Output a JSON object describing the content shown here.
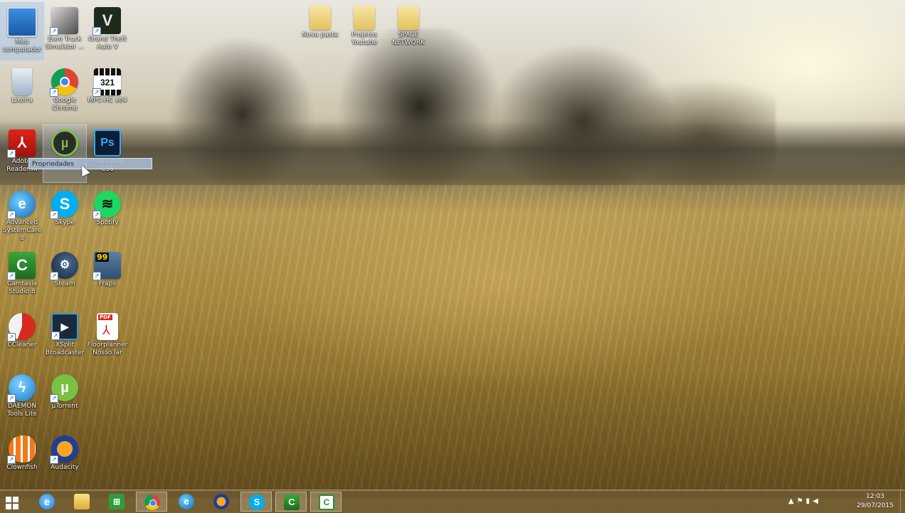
{
  "desktop": {
    "icons": [
      {
        "label": "Meu computador",
        "icon": "computer-icon"
      },
      {
        "label": "Euro Truck Simulator ...",
        "icon": "truck-icon"
      },
      {
        "label": "Grand Theft Auto V",
        "icon": "gta-icon"
      },
      {
        "label": "Lixeira",
        "icon": "recycle-bin-icon"
      },
      {
        "label": "Google Chrome",
        "icon": "chrome-icon"
      },
      {
        "label": "MPC-HC x64",
        "icon": "mpc-hc-icon"
      },
      {
        "label": "Adobe Reader XI",
        "icon": "acrobat-icon"
      },
      {
        "label": "uTorrent",
        "icon": "utorrent-icon"
      },
      {
        "label": "Photoshop CS6",
        "icon": "photoshop-icon"
      },
      {
        "label": "Advanced SystemCare 8",
        "icon": "advanced-systemcare-icon"
      },
      {
        "label": "Skype",
        "icon": "skype-icon"
      },
      {
        "label": "Spotify",
        "icon": "spotify-icon"
      },
      {
        "label": "Camtasia Studio 8",
        "icon": "camtasia-icon"
      },
      {
        "label": "Steam",
        "icon": "steam-icon"
      },
      {
        "label": "Fraps",
        "icon": "fraps-icon"
      },
      {
        "label": "CCleaner",
        "icon": "ccleaner-icon"
      },
      {
        "label": "XSplit Broadcaster",
        "icon": "xsplit-icon"
      },
      {
        "label": "Floorplanner Nosso lar",
        "icon": "pdf-icon"
      },
      {
        "label": "DAEMON Tools Lite",
        "icon": "daemon-tools-icon"
      },
      {
        "label": "µTorrent",
        "icon": "utorrent-icon"
      },
      {
        "label": "Clownfish",
        "icon": "clownfish-icon"
      },
      {
        "label": "Audacity",
        "icon": "audacity-icon"
      }
    ],
    "folders": [
      {
        "label": "Nova pasta",
        "icon": "folder-icon"
      },
      {
        "label": "Projetos Youtube",
        "icon": "folder-icon"
      },
      {
        "label": "SPACE NETWORK",
        "icon": "folder-icon"
      }
    ],
    "drag_label": "Propriedades"
  },
  "taskbar": {
    "buttons": [
      {
        "name": "start",
        "icon": "windows-logo-icon"
      },
      {
        "name": "internet-explorer",
        "icon": "internet-explorer-icon"
      },
      {
        "name": "file-explorer",
        "icon": "file-explorer-icon"
      },
      {
        "name": "store",
        "icon": "store-icon"
      },
      {
        "name": "chrome",
        "icon": "chrome-icon"
      },
      {
        "name": "advanced-systemcare",
        "icon": "advanced-systemcare-icon"
      },
      {
        "name": "audacity",
        "icon": "audacity-icon"
      },
      {
        "name": "skype",
        "icon": "skype-icon"
      },
      {
        "name": "camtasia",
        "icon": "camtasia-icon"
      },
      {
        "name": "camtasia-recorder",
        "icon": "camtasia-recorder-icon"
      }
    ],
    "clock_time": "12:03",
    "clock_date": "29/07/2015"
  },
  "colors": {
    "accent": "#2b79d6",
    "taskbar": "#786438"
  }
}
